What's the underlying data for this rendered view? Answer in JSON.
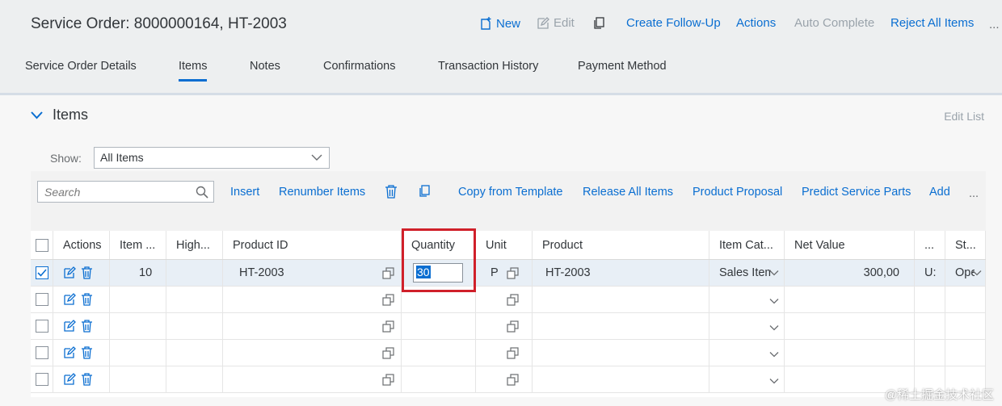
{
  "header": {
    "title": "Service Order: 8000000164, HT-2003",
    "actions": {
      "new": "New",
      "edit": "Edit",
      "create_follow_up": "Create Follow-Up",
      "actions": "Actions",
      "auto_complete": "Auto Complete",
      "reject_all": "Reject All Items",
      "more": "..."
    },
    "tabs": [
      {
        "label": "Service Order Details"
      },
      {
        "label": "Items",
        "active": true
      },
      {
        "label": "Notes"
      },
      {
        "label": "Confirmations"
      },
      {
        "label": "Transaction History"
      },
      {
        "label": "Payment Method"
      }
    ]
  },
  "section": {
    "title": "Items",
    "edit_list": "Edit List",
    "show_label": "Show:",
    "show_value": "All Items"
  },
  "toolbar": {
    "search_placeholder": "Search",
    "insert": "Insert",
    "renumber": "Renumber Items",
    "copy_template": "Copy from Template",
    "release_all": "Release All Items",
    "product_proposal": "Product Proposal",
    "predict_parts": "Predict Service Parts",
    "add": "Add",
    "more": "..."
  },
  "table": {
    "columns": [
      "Actions",
      "Item ...",
      "High...",
      "Product ID",
      "Quantity",
      "Unit",
      "Product",
      "Item Cat...",
      "Net Value",
      "...",
      "St..."
    ],
    "rows": [
      {
        "item": "10",
        "product_id": "HT-2003",
        "quantity": "30",
        "unit": "P",
        "product": "HT-2003",
        "item_cat": "Sales Item",
        "net_value": "300,00",
        "currency": "U:",
        "status": "Ope"
      }
    ]
  },
  "watermark": "@稀土掘金技术社区",
  "colors": {
    "accent": "#0a6ed1",
    "highlight": "#d0202a"
  }
}
